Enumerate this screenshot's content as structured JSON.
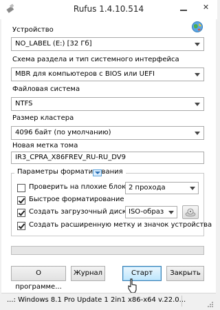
{
  "window": {
    "title": "Rufus 1.4.10.514",
    "minimize_icon": "minimize-icon",
    "close_label": "✕"
  },
  "device": {
    "label": "Устройство",
    "value": "NO_LABEL (E:) [32 Гб]"
  },
  "partition": {
    "label": "Схема раздела и тип системного интерфейса",
    "value": "MBR для компьютеров с BIOS или UEFI"
  },
  "filesystem": {
    "label": "Файловая система",
    "value": "NTFS"
  },
  "cluster": {
    "label": "Размер кластера",
    "value": "4096 байт (по умолчанию)"
  },
  "volume": {
    "label": "Новая метка тома",
    "value": "IR3_CPRA_X86FREV_RU-RU_DV9"
  },
  "format_options": {
    "title": "Параметры форматирования",
    "bad_blocks": {
      "label": "Проверить на плохие блоки:",
      "checked": false,
      "passes": "2 прохода"
    },
    "quick_format": {
      "label": "Быстрое форматирование",
      "checked": true
    },
    "bootable": {
      "label": "Создать загрузочный диск:",
      "checked": true,
      "type": "ISO-образ"
    },
    "extended_label": {
      "label": "Создать расширенную метку и значок устройства",
      "checked": true
    }
  },
  "progress": {
    "fraction": 0.0
  },
  "buttons": {
    "about": "О программе...",
    "log": "Журнал",
    "start": "Старт",
    "close": "Закрыть"
  },
  "status": {
    "text": "...: Windows 8.1 Pro Update 1 2in1 x86-x64 v.22.0..."
  }
}
